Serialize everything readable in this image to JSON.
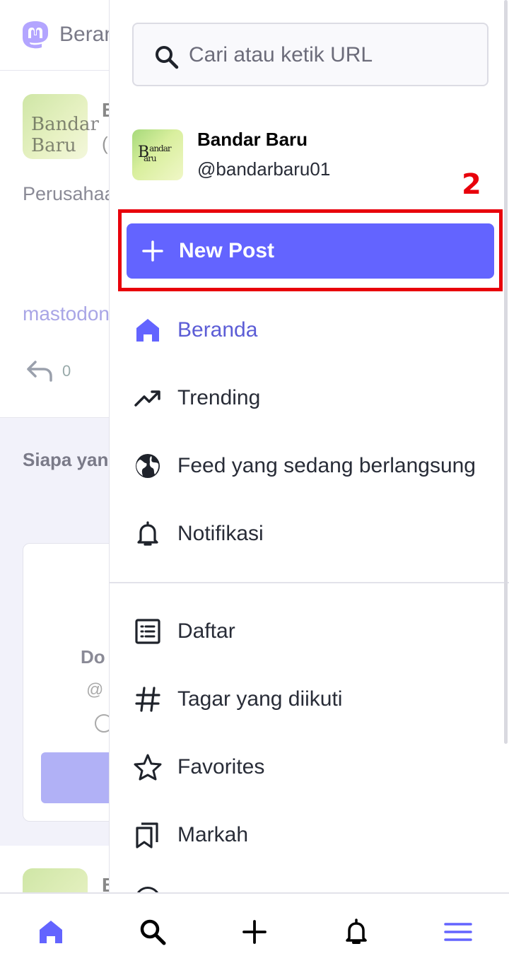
{
  "background": {
    "header_title": "Beranda",
    "post": {
      "avatar_text": "Bandar Baru",
      "name_initial": "B",
      "text": "Perusahaan bagaimana melalui p",
      "link": "mastodon",
      "reply_count": "0"
    },
    "suggestions": {
      "title": "Siapa yang diikuti",
      "card_name": "Do",
      "card_handle": "@"
    }
  },
  "drawer": {
    "search": {
      "placeholder": "Cari atau ketik URL",
      "value": ""
    },
    "account": {
      "avatar_text": "Bandar Baru",
      "name": "Bandar Baru",
      "handle": "@bandarbaru01"
    },
    "annotation_number": "2",
    "new_post_label": "New Post",
    "nav_primary": [
      {
        "label": "Beranda",
        "icon": "home-icon",
        "active": true
      },
      {
        "label": "Trending",
        "icon": "trending-icon",
        "active": false
      },
      {
        "label": "Feed yang sedang berlangsung",
        "icon": "globe-icon",
        "active": false
      },
      {
        "label": "Notifikasi",
        "icon": "bell-icon",
        "active": false
      }
    ],
    "nav_secondary": [
      {
        "label": "Daftar",
        "icon": "list-icon"
      },
      {
        "label": "Tagar yang diikuti",
        "icon": "hashtag-icon"
      },
      {
        "label": "Favorites",
        "icon": "star-icon"
      },
      {
        "label": "Markah",
        "icon": "bookmarks-icon"
      }
    ]
  },
  "tabbar": [
    {
      "name": "home",
      "icon": "home-icon",
      "active": true
    },
    {
      "name": "search",
      "icon": "search-icon",
      "active": false
    },
    {
      "name": "compose",
      "icon": "plus-icon",
      "active": false
    },
    {
      "name": "notifications",
      "icon": "bell-icon",
      "active": false
    },
    {
      "name": "menu",
      "icon": "menu-icon",
      "active": true
    }
  ],
  "colors": {
    "accent": "#6364ff",
    "active_text": "#5c5dd6",
    "annotation": "#e8000b",
    "text": "#282c37"
  }
}
